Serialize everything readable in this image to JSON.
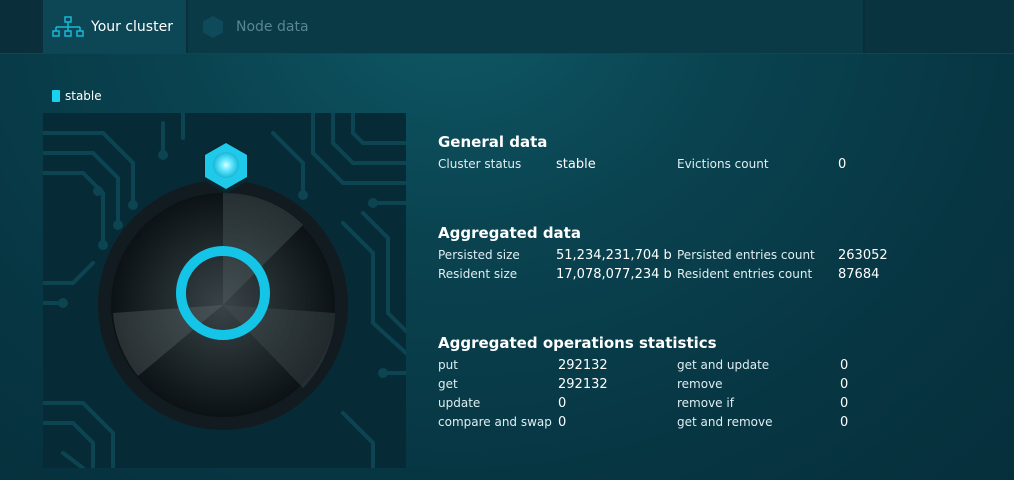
{
  "tabs": {
    "cluster_label": "Your cluster",
    "node_label": "Node data"
  },
  "status": {
    "label": "stable",
    "color": "#19d2ef"
  },
  "general": {
    "title": "General data",
    "cluster_status_label": "Cluster status",
    "cluster_status_value": "stable",
    "evictions_label": "Evictions count",
    "evictions_value": "0"
  },
  "aggregated": {
    "title": "Aggregated data",
    "persisted_size_label": "Persisted size",
    "persisted_size_value": "51,234,231,704 b",
    "resident_size_label": "Resident size",
    "resident_size_value": "17,078,077,234 b",
    "persisted_entries_label": "Persisted entries count",
    "persisted_entries_value": "263052",
    "resident_entries_label": "Resident entries count",
    "resident_entries_value": "87684"
  },
  "operations": {
    "title": "Aggregated operations statistics",
    "left": [
      {
        "label": "put",
        "value": "292132"
      },
      {
        "label": "get",
        "value": "292132"
      },
      {
        "label": "update",
        "value": "0"
      },
      {
        "label": "compare and swap",
        "value": "0"
      }
    ],
    "right": [
      {
        "label": "get and update",
        "value": "0"
      },
      {
        "label": "remove",
        "value": "0"
      },
      {
        "label": "remove if",
        "value": "0"
      },
      {
        "label": "get and remove",
        "value": "0"
      }
    ]
  },
  "icons": {
    "cluster_tab": "network-tree-icon",
    "node_tab": "hexagon-icon",
    "node_marker": "glowing-hexagon-node-icon"
  },
  "colors": {
    "accent": "#19d2ef",
    "tab_active": "#0d4756"
  }
}
